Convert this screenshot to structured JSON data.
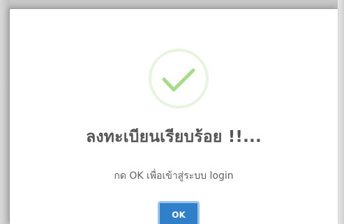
{
  "dialog": {
    "icon": "checkmark-success-icon",
    "title": "ลงทะเบียนเรียบร้อย !!...",
    "message": "กด OK เพื่อเข้าสู่ระบบ login",
    "ok_label": "OK"
  },
  "colors": {
    "success": "#a5dc86",
    "button": "#2f80c9"
  }
}
